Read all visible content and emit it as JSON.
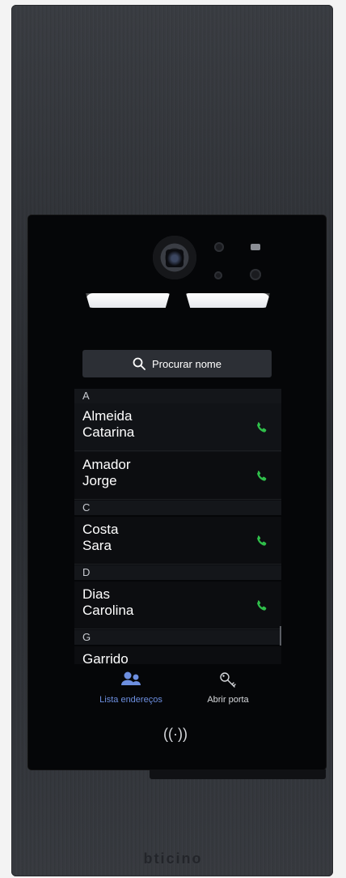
{
  "search": {
    "label": "Procurar nome"
  },
  "contacts": [
    {
      "section": "A",
      "entries": [
        {
          "first_line": "Almeida",
          "second_line": "Catarina"
        },
        {
          "first_line": "Amador",
          "second_line": "Jorge"
        }
      ]
    },
    {
      "section": "C",
      "entries": [
        {
          "first_line": "Costa",
          "second_line": "Sara"
        }
      ]
    },
    {
      "section": "D",
      "entries": [
        {
          "first_line": "Dias",
          "second_line": "Carolina"
        }
      ]
    },
    {
      "section": "G",
      "entries": [
        {
          "first_line": "Garrido",
          "second_line": ""
        }
      ]
    }
  ],
  "tabs": {
    "contacts_label": "Lista endereços",
    "door_label": "Abrir porta"
  },
  "nfc": {
    "symbol": "((·))"
  },
  "brand": {
    "name": "bticino"
  },
  "colors": {
    "call_icon": "#2fbf4a",
    "active_tab": "#6d8fe0",
    "inactive_tab": "#d6d8dc",
    "search_bg": "#2c2f35"
  }
}
